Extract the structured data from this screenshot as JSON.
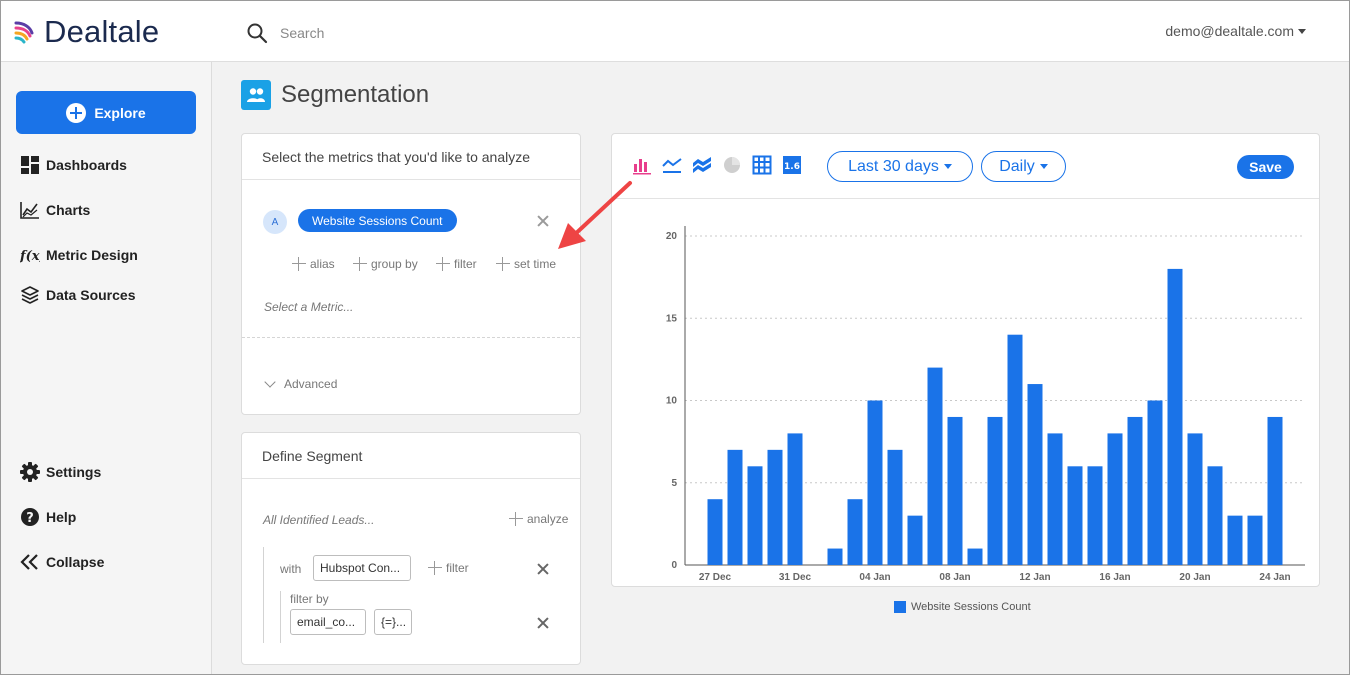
{
  "app": {
    "name": "Dealtale"
  },
  "header": {
    "search_placeholder": "Search",
    "user_email": "demo@dealtale.com"
  },
  "sidebar": {
    "explore_label": "Explore",
    "items": [
      {
        "label": "Dashboards",
        "icon": "dashboard-grid-icon"
      },
      {
        "label": "Charts",
        "icon": "line-chart-icon"
      },
      {
        "label": "Metric Design",
        "icon": "function-icon"
      },
      {
        "label": "Data Sources",
        "icon": "layers-icon"
      }
    ],
    "bottom_items": [
      {
        "label": "Settings",
        "icon": "gear-icon"
      },
      {
        "label": "Help",
        "icon": "help-icon"
      },
      {
        "label": "Collapse",
        "icon": "collapse-icon"
      }
    ]
  },
  "page": {
    "title": "Segmentation",
    "title_icon": "people-icon"
  },
  "metrics_card": {
    "header": "Select the metrics that you'd like to analyze",
    "badge": "A",
    "metric": "Website Sessions Count",
    "options": [
      "alias",
      "group by",
      "filter",
      "set time"
    ],
    "select_placeholder": "Select a Metric...",
    "advanced_label": "Advanced"
  },
  "segment_card": {
    "header": "Define Segment",
    "leads_label": "All Identified Leads...",
    "analyze_label": "analyze",
    "with_label": "with",
    "source_value": "Hubspot Con...",
    "filter_label": "filter",
    "filter_by_label": "filter by",
    "field_value": "email_co...",
    "operator_value": "{=}..."
  },
  "chart_panel": {
    "chart_type_icons": [
      "bar-chart-icon",
      "line-chart-icon",
      "area-chart-icon",
      "pie-chart-icon",
      "table-icon",
      "number-icon"
    ],
    "number_icon_text": "1.6",
    "range_label": "Last 30 days",
    "interval_label": "Daily",
    "save_label": "Save"
  },
  "colors": {
    "accent": "#1a73e8",
    "bar_icon_active": "#e83e8c",
    "title_icon": "#1aa1e6",
    "annotation_arrow": "#ee4444"
  },
  "chart_data": {
    "type": "bar",
    "title": "",
    "xlabel": "",
    "ylabel": "",
    "ylim": [
      0,
      20
    ],
    "yticks": [
      0,
      5,
      10,
      15,
      20
    ],
    "x_tick_labels": [
      "27 Dec",
      "31 Dec",
      "04 Jan",
      "08 Jan",
      "12 Jan",
      "16 Jan",
      "20 Jan",
      "24 Jan"
    ],
    "categories": [
      "26 Dec",
      "27 Dec",
      "28 Dec",
      "29 Dec",
      "30 Dec",
      "31 Dec",
      "01 Jan",
      "02 Jan",
      "03 Jan",
      "04 Jan",
      "05 Jan",
      "06 Jan",
      "07 Jan",
      "08 Jan",
      "09 Jan",
      "10 Jan",
      "11 Jan",
      "12 Jan",
      "13 Jan",
      "14 Jan",
      "15 Jan",
      "16 Jan",
      "17 Jan",
      "18 Jan",
      "19 Jan",
      "20 Jan",
      "21 Jan",
      "22 Jan",
      "23 Jan",
      "24 Jan",
      "25 Jan"
    ],
    "series": [
      {
        "name": "Website Sessions Count",
        "color": "#1a73e8",
        "values": [
          0,
          4,
          7,
          6,
          7,
          8,
          0,
          1,
          4,
          10,
          7,
          3,
          12,
          9,
          1,
          9,
          14,
          11,
          8,
          6,
          6,
          8,
          9,
          10,
          18,
          8,
          6,
          3,
          3,
          9,
          0
        ]
      }
    ],
    "legend_position": "bottom-center",
    "grid": true
  }
}
